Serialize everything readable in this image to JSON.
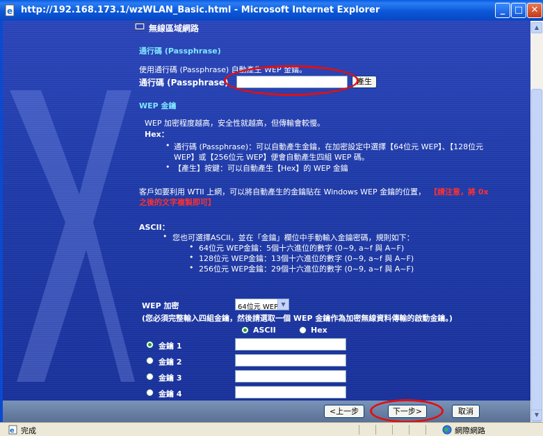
{
  "window": {
    "title": "http://192.168.173.1/wzWLAN_Basic.html - Microsoft Internet Explorer",
    "min_glyph": "_",
    "max_glyph": "□",
    "close_glyph": "✕"
  },
  "header": {
    "section_title": "無線區域網路"
  },
  "passphrase": {
    "heading": "通行碼 (Passphrase)",
    "desc": "使用通行碼 (Passphrase) 自動產生 WEP 金鑰。",
    "label": "通行碼 (Passphrase)",
    "value": "",
    "generate_button": "產生"
  },
  "wepkey": {
    "heading": "WEP 金鑰",
    "line1": "WEP 加密程度越高，安全性就越高，但傳輸會較慢。",
    "hex_label": "Hex：",
    "hex_bullet1_a": "通行碼 (Passphrase)：可以自動產生金鑰，在加密設定中選擇【64位元 WEP】、【128位元",
    "hex_bullet1_b": "WEP】或【256位元 WEP】便會自動產生四組 WEP 碼。",
    "hex_bullet2": "【產生】按鍵：可以自動產生【Hex】的 WEP 金鑰",
    "customer_text": "客戶如要利用 WTII 上網，可以將自動產生的金鑰貼在 Windows WEP 金鑰的位置，",
    "customer_red_a": "【請注意，將 0x",
    "customer_red_b": "之後的文字複製即可】",
    "ascii_label": "ASCII：",
    "ascii_bullet": "您也可選擇ASCII，並在「金鑰」欄位中手動輸入金鑰密碼，規則如下：",
    "ascii_sub": [
      "64位元 WEP金鑰：5個十六進位的數字 (0~9, a~f 與 A~F)",
      "128位元 WEP金鑰：13個十六進位的數字 (0~9, a~f 與 A~F)",
      "256位元 WEP金鑰：29個十六進位的數字 (0~9, a~f 與 A~F)"
    ]
  },
  "wep_encrypt": {
    "label": "WEP 加密",
    "selected": "64位元 WEP",
    "note": "(您必須完整輸入四組金鑰，然後請選取一個 WEP 金鑰作為加密無線資料傳輸的啟動金鑰。)",
    "format_ascii": "ASCII",
    "format_hex": "Hex",
    "format_selected": "ASCII",
    "keys": [
      {
        "label": "金鑰 1",
        "selected": true,
        "value": ""
      },
      {
        "label": "金鑰 2",
        "selected": false,
        "value": ""
      },
      {
        "label": "金鑰 3",
        "selected": false,
        "value": ""
      },
      {
        "label": "金鑰 4",
        "selected": false,
        "value": ""
      }
    ]
  },
  "nav": {
    "back_button": "<上一步",
    "next_button": "下一步>",
    "cancel_button": "取消"
  },
  "status": {
    "text": "完成",
    "zone": "網際網路"
  },
  "colors": {
    "titlebar": "#0b58d8",
    "content_bg": "#1e3aa8",
    "accent_cyan": "#7fe6ff",
    "annotation_red": "#e01010"
  }
}
